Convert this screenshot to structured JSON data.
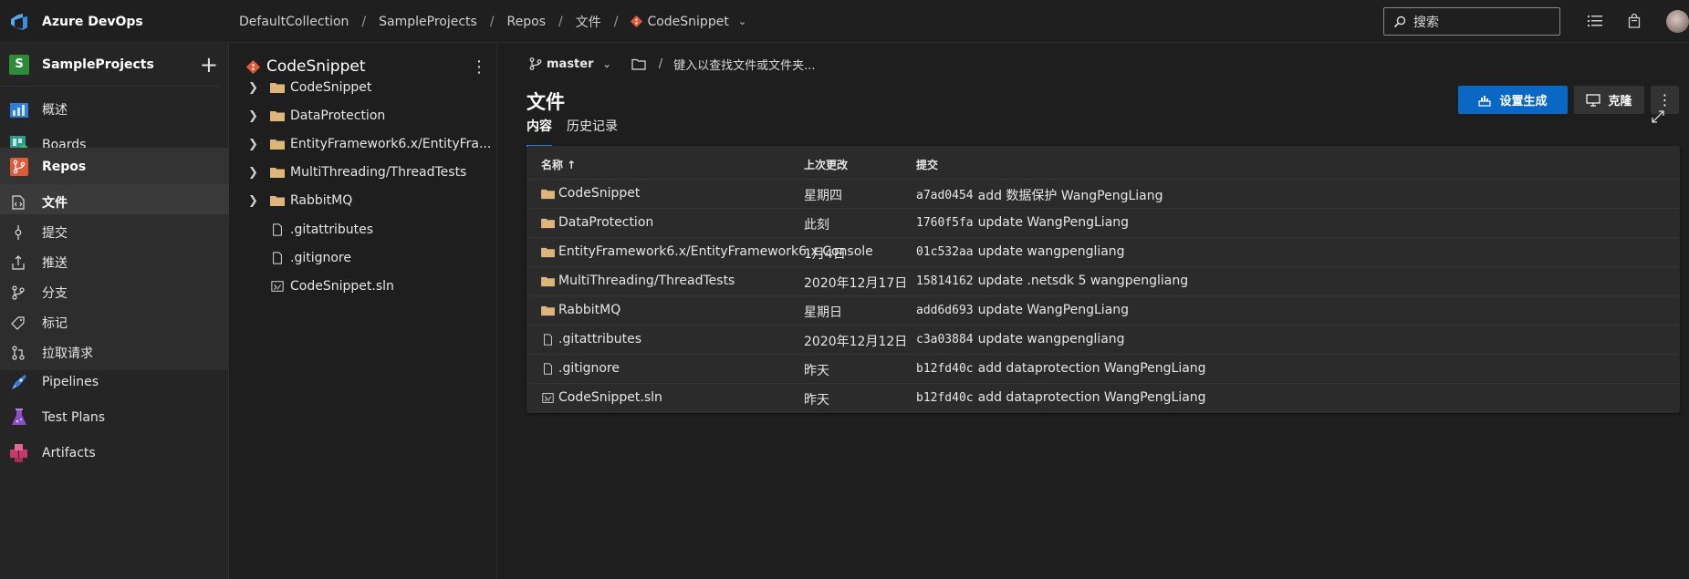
{
  "app": {
    "name": "Azure DevOps"
  },
  "breadcrumb": [
    "DefaultCollection",
    "SampleProjects",
    "Repos",
    "文件",
    "CodeSnippet"
  ],
  "search": {
    "placeholder": "搜索"
  },
  "sidebar": {
    "project_initial": "S",
    "project_name": "SampleProjects",
    "items": [
      {
        "label": "概述",
        "icon": "overview-icon"
      },
      {
        "label": "Boards",
        "icon": "boards-icon"
      },
      {
        "label": "Repos",
        "icon": "repos-icon",
        "selected": true
      },
      {
        "label": "Pipelines",
        "icon": "pipelines-icon"
      },
      {
        "label": "Test Plans",
        "icon": "test-plans-icon"
      },
      {
        "label": "Artifacts",
        "icon": "artifacts-icon"
      }
    ],
    "repos_sub": [
      {
        "label": "文件",
        "icon": "file-code-icon",
        "active": true
      },
      {
        "label": "提交",
        "icon": "commit-icon"
      },
      {
        "label": "推送",
        "icon": "push-icon"
      },
      {
        "label": "分支",
        "icon": "branch-icon"
      },
      {
        "label": "标记",
        "icon": "tag-icon"
      },
      {
        "label": "拉取请求",
        "icon": "pull-request-icon"
      }
    ]
  },
  "tree": {
    "repo": "CodeSnippet",
    "items": [
      {
        "label": "CodeSnippet",
        "type": "folder"
      },
      {
        "label": "DataProtection",
        "type": "folder"
      },
      {
        "label": "EntityFramework6.x/EntityFra...",
        "type": "folder"
      },
      {
        "label": "MultiThreading/ThreadTests",
        "type": "folder"
      },
      {
        "label": "RabbitMQ",
        "type": "folder"
      },
      {
        "label": ".gitattributes",
        "type": "file"
      },
      {
        "label": ".gitignore",
        "type": "file"
      },
      {
        "label": "CodeSnippet.sln",
        "type": "sln"
      }
    ]
  },
  "main": {
    "branch": "master",
    "path_placeholder": "键入以查找文件或文件夹...",
    "title": "文件",
    "setup_build": "设置生成",
    "clone": "克隆",
    "tabs": [
      "内容",
      "历史记录"
    ],
    "columns": [
      "名称 ↑",
      "上次更改",
      "提交"
    ],
    "rows": [
      {
        "name": "CodeSnippet",
        "type": "folder",
        "changed": "星期四",
        "hash": "a7ad0454",
        "message": "add 数据保护 WangPengLiang"
      },
      {
        "name": "DataProtection",
        "type": "folder",
        "changed": "此刻",
        "hash": "1760f5fa",
        "message": "update WangPengLiang"
      },
      {
        "name": "EntityFramework6.x/EntityFramework6.x.Console",
        "type": "folder",
        "changed": "1月4日",
        "hash": "01c532aa",
        "message": "update wangpengliang"
      },
      {
        "name": "MultiThreading/ThreadTests",
        "type": "folder",
        "changed": "2020年12月17日",
        "hash": "15814162",
        "message": "update .netsdk 5 wangpengliang"
      },
      {
        "name": "RabbitMQ",
        "type": "folder",
        "changed": "星期日",
        "hash": "add6d693",
        "message": "update WangPengLiang"
      },
      {
        "name": ".gitattributes",
        "type": "file",
        "changed": "2020年12月12日",
        "hash": "c3a03884",
        "message": "update wangpengliang"
      },
      {
        "name": ".gitignore",
        "type": "file",
        "changed": "昨天",
        "hash": "b12fd40c",
        "message": "add dataprotection WangPengLiang"
      },
      {
        "name": "CodeSnippet.sln",
        "type": "sln",
        "changed": "昨天",
        "hash": "b12fd40c",
        "message": "add dataprotection WangPengLiang"
      }
    ]
  },
  "colors": {
    "accent": "#0a67c4",
    "folder": "#dcb67a",
    "repo": "#e05a3a",
    "tab_underline": "#2f8ae0"
  }
}
